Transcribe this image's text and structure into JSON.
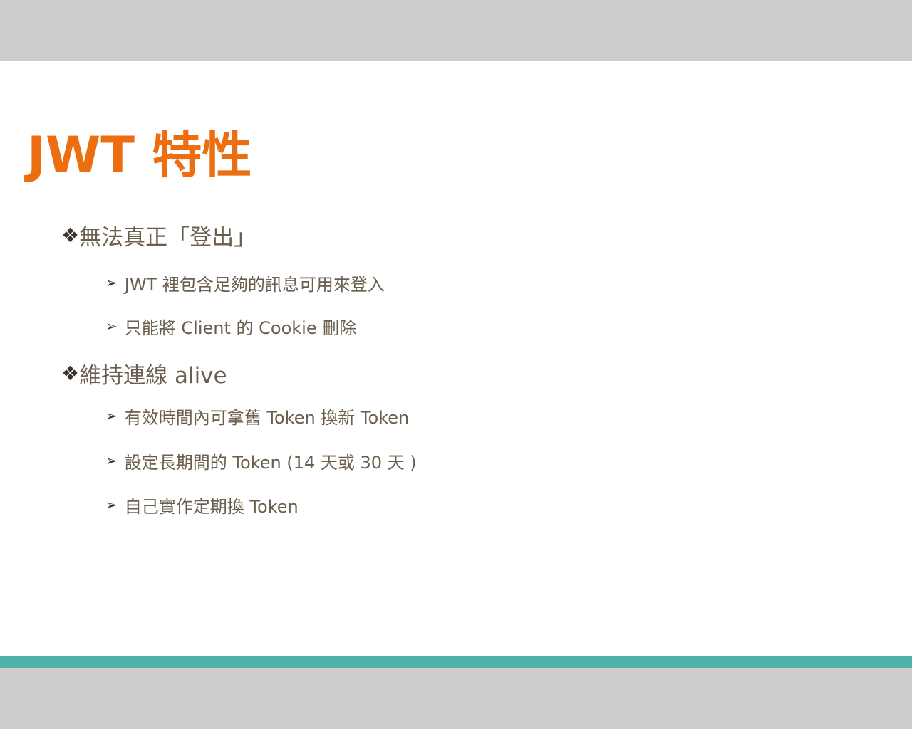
{
  "slide": {
    "title": "JWT 特性",
    "sections": [
      {
        "marker": "❖",
        "heading": "無法真正「登出」",
        "items": [
          {
            "marker": "➢",
            "text": "JWT  裡包含足夠的訊息可用來登入"
          },
          {
            "marker": "➢",
            "text": "只能將 Client  的 Cookie 刪除"
          }
        ]
      },
      {
        "marker": "❖",
        "heading": "維持連線 alive",
        "items": [
          {
            "marker": "➢",
            "text": "有效時間內可拿舊 Token 換新 Token"
          },
          {
            "marker": "➢",
            "text": "設定長期間的 Token (14 天或 30 天 )"
          },
          {
            "marker": "➢",
            "text": "自己實作定期換 Token"
          }
        ]
      }
    ]
  },
  "colors": {
    "title": "#ec6e10",
    "body_text": "#6b5e4d",
    "accent_bar": "#4fb3aa",
    "frame": "#cccccc"
  }
}
